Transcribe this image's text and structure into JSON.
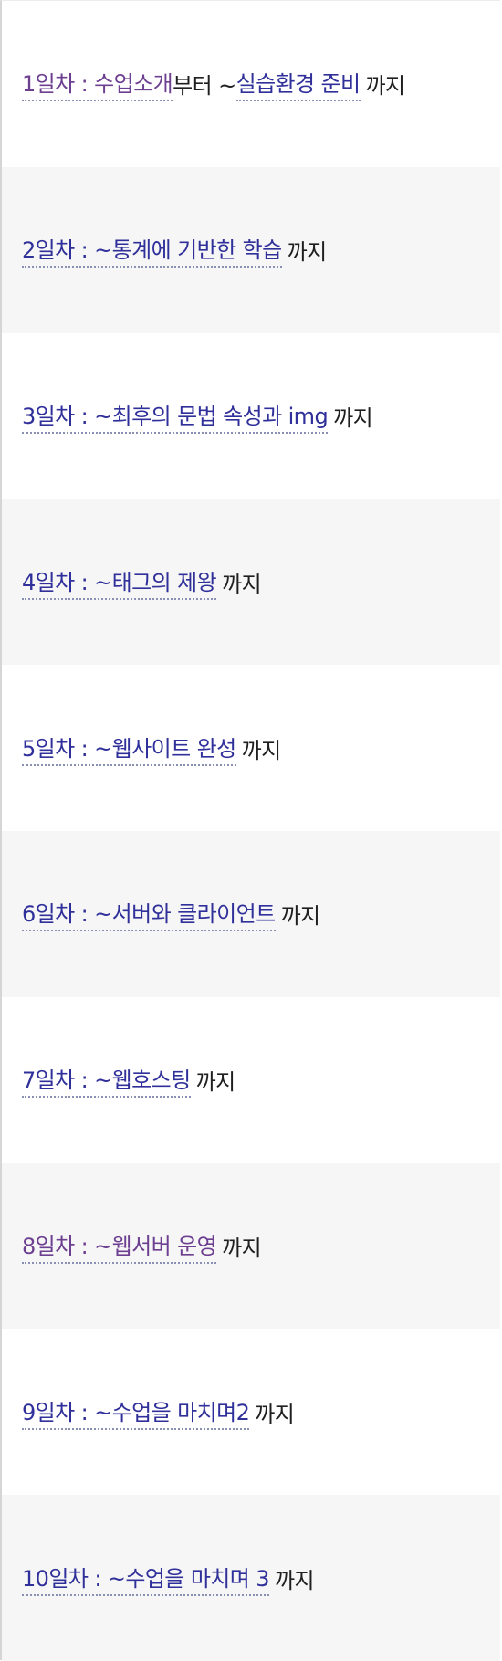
{
  "suffix": "까지",
  "items": [
    {
      "link1": "1일차 : 수업소개",
      "mid": "부터 ~ ",
      "link2": "실습환경 준비",
      "visited": true
    },
    {
      "link1": "2일차 : ~통계에 기반한 학습"
    },
    {
      "link1": "3일차 : ~최후의 문법 속성과 img"
    },
    {
      "link1": "4일차 : ~태그의 제왕"
    },
    {
      "link1": "5일차 : ~웹사이트 완성"
    },
    {
      "link1": "6일차 : ~서버와 클라이언트"
    },
    {
      "link1": "7일차 : ~웹호스팅"
    },
    {
      "link1": "8일차 : ~웹서버 운영",
      "visited": true
    },
    {
      "link1": "9일차 : ~수업을 마치며2"
    },
    {
      "link1": "10일차 : ~수업을 마치며 3"
    }
  ]
}
